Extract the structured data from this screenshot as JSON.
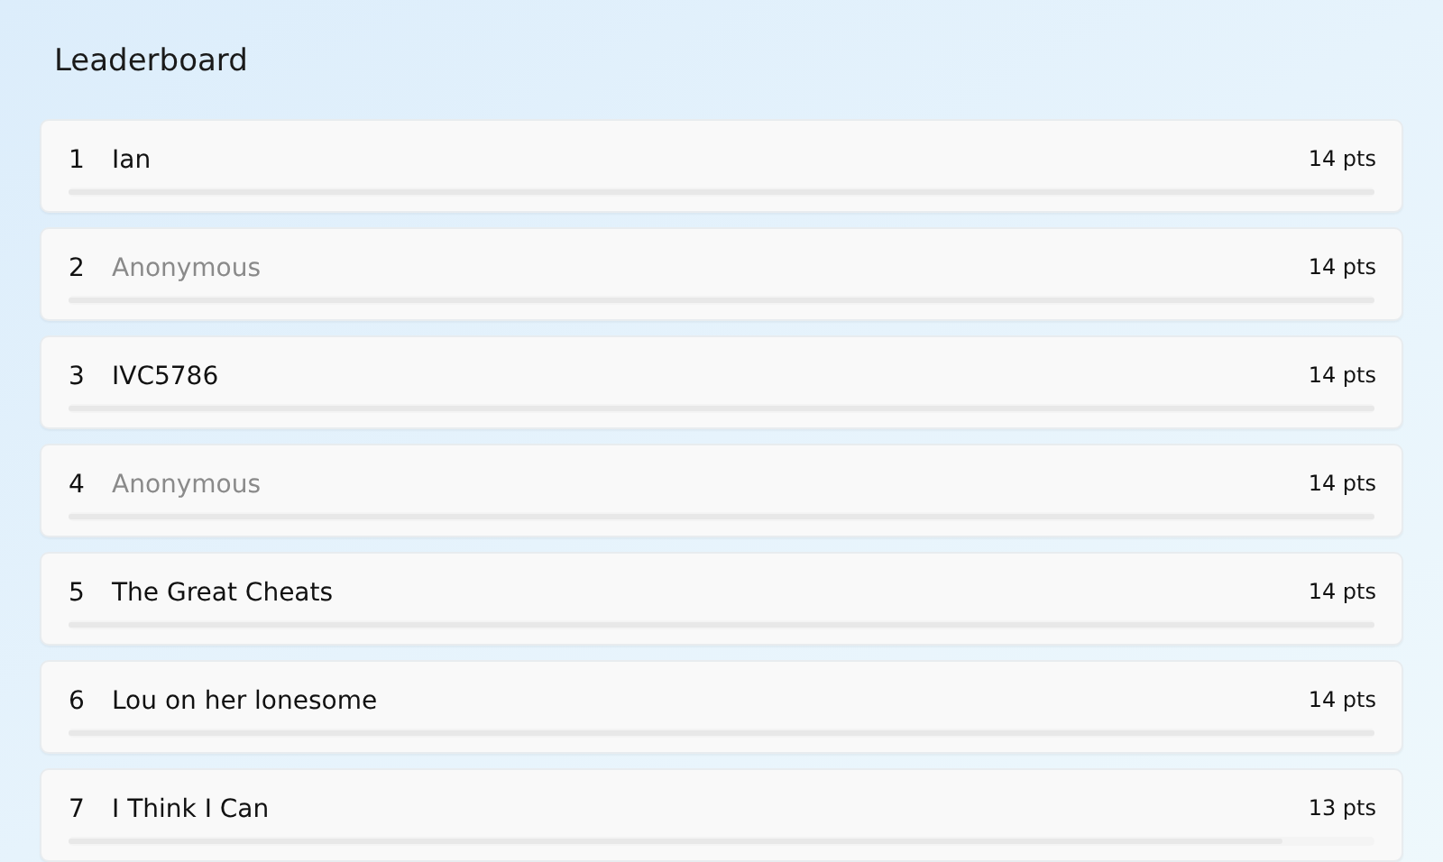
{
  "title": "Leaderboard",
  "entries": [
    {
      "rank": "1",
      "name": "Ian",
      "anonymous": false,
      "points": "14 pts",
      "level": 1
    },
    {
      "rank": "2",
      "name": "Anonymous",
      "anonymous": true,
      "points": "14 pts",
      "level": 1
    },
    {
      "rank": "3",
      "name": "IVC5786",
      "anonymous": false,
      "points": "14 pts",
      "level": 1
    },
    {
      "rank": "4",
      "name": "Anonymous",
      "anonymous": true,
      "points": "14 pts",
      "level": 1
    },
    {
      "rank": "5",
      "name": "The Great Cheats",
      "anonymous": false,
      "points": "14 pts",
      "level": 1
    },
    {
      "rank": "6",
      "name": "Lou on her lonesome",
      "anonymous": false,
      "points": "14 pts",
      "level": 1
    },
    {
      "rank": "7",
      "name": "I Think I Can",
      "anonymous": false,
      "points": "13 pts",
      "level": 0.93
    }
  ]
}
